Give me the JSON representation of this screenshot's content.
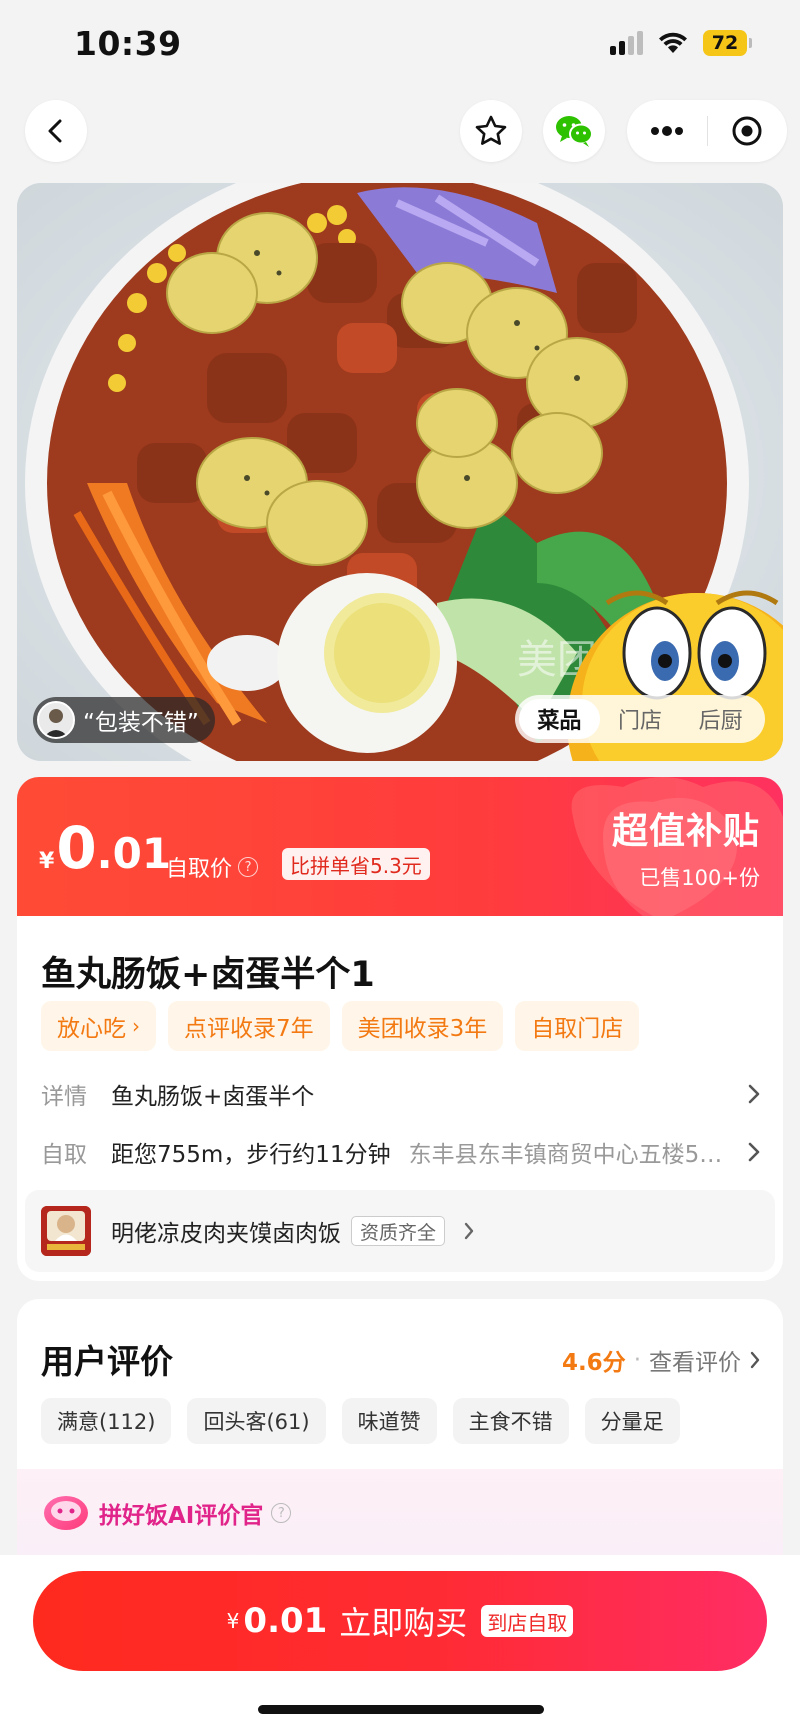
{
  "status_bar": {
    "time": "10:39",
    "battery": "72"
  },
  "hero": {
    "review_quote": "“包装不错”",
    "watermark": "美团",
    "tabs": [
      {
        "label": "菜品",
        "active": true
      },
      {
        "label": "门店",
        "active": false
      },
      {
        "label": "后厨",
        "active": false
      }
    ]
  },
  "price": {
    "currency": "¥",
    "integer": "0",
    "decimal": ".01",
    "label": "自取价",
    "help": "?",
    "save_badge": "比拼单省5.3元",
    "promo_title": "超值补贴",
    "sold": "已售100+份"
  },
  "product": {
    "title": "鱼丸肠饭+卤蛋半个1",
    "tags": [
      {
        "label": "放心吃",
        "chevron": "›"
      },
      {
        "label": "点评收录7年"
      },
      {
        "label": "美团收录3年"
      },
      {
        "label": "自取门店"
      }
    ],
    "detail_key": "详情",
    "detail_value": "鱼丸肠饭+卤蛋半个",
    "pickup_key": "自取",
    "pickup_value": "距您755m，步行约11分钟",
    "pickup_address": "东丰县东丰镇商贸中心五楼5…",
    "shop_name": "明佬凉皮肉夹馍卤肉饭",
    "shop_badge": "资质齐全"
  },
  "reviews": {
    "title": "用户评价",
    "score": "4.6分",
    "dot": "·",
    "see_all": "查看评价",
    "tags": [
      "满意(112)",
      "回头客(61)",
      "味道赞",
      "主食不错",
      "分量足"
    ],
    "ai_title": "拼好饭AI评价官",
    "ai_help": "?"
  },
  "bottom": {
    "currency": "¥",
    "price": "0.01",
    "label": "立即购买",
    "badge": "到店自取"
  },
  "colors": {
    "accent_red": "#ff2b33",
    "orange": "#f37a12",
    "pink": "#e0248a"
  }
}
